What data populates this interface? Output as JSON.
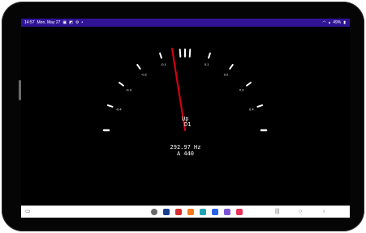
{
  "status_bar": {
    "time": "14:57",
    "date": "Mon, May 27",
    "battery": "49%",
    "left_icons": [
      "notification-icon",
      "photo-icon",
      "settings-icon",
      "menu-dots-icon"
    ],
    "right_icons": [
      "wifi-icon",
      "signal-icon",
      "battery-icon"
    ]
  },
  "gauge": {
    "tick_labels": [
      "-0.4",
      "-0.3",
      "-0.2",
      "-0.1",
      "0.1",
      "0.2",
      "0.3",
      "0.4"
    ],
    "needle_value": -0.05,
    "needle_color": "#d30013",
    "note_direction": "Up",
    "note_name": "D1"
  },
  "readout": {
    "frequency": "292.97 Hz",
    "reference": "A 440"
  },
  "taskbar": {
    "apps": [
      {
        "name": "apps-grid-icon",
        "color": "#6a6a6a"
      },
      {
        "name": "blue-app-icon",
        "color": "#1a3d8f"
      },
      {
        "name": "red-app-icon",
        "color": "#d62d2d"
      },
      {
        "name": "orange-app-icon",
        "color": "#f27b1a"
      },
      {
        "name": "teal-app-icon",
        "color": "#1fa3b5"
      },
      {
        "name": "messages-app-icon",
        "color": "#2a62e8"
      },
      {
        "name": "purple-app-icon",
        "color": "#7b55d6"
      },
      {
        "name": "pink-app-icon",
        "color": "#e6335b"
      }
    ]
  }
}
